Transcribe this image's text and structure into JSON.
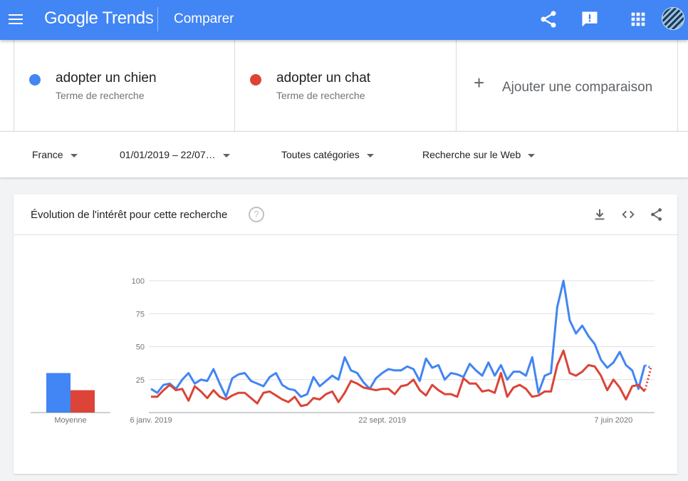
{
  "header": {
    "logo_google": "Google",
    "logo_trends": "Trends",
    "page_title": "Comparer",
    "icons": [
      "menu-icon",
      "share-icon",
      "feedback-icon",
      "apps-icon",
      "avatar"
    ],
    "bar_color": "#4285f4"
  },
  "terms": [
    {
      "name": "adopter un chien",
      "subtitle": "Terme de recherche",
      "color": "#4285f4"
    },
    {
      "name": "adopter un chat",
      "subtitle": "Terme de recherche",
      "color": "#db4437"
    }
  ],
  "add_comparison": {
    "plus": "+",
    "label": "Ajouter une comparaison"
  },
  "filters": {
    "region": "France",
    "date_range": "01/01/2019 – 22/07…",
    "category": "Toutes catégories",
    "search_type": "Recherche sur le Web"
  },
  "card": {
    "title": "Évolution de l'intérêt pour cette recherche",
    "help": "?",
    "icons": [
      "download-icon",
      "embed-icon",
      "share-icon"
    ]
  },
  "chart_data": {
    "type": "line",
    "title": "",
    "y_ticks": [
      "100",
      "75",
      "50",
      "25"
    ],
    "ylim": [
      0,
      100
    ],
    "x_ticks": [
      "6 janv. 2019",
      "22 sept. 2019",
      "7 juin 2020"
    ],
    "x_tick_index": [
      0,
      37,
      74
    ],
    "series": [
      {
        "name": "adopter un chien",
        "color": "#4285f4",
        "values": [
          18,
          15,
          21,
          22,
          18,
          25,
          30,
          22,
          25,
          24,
          33,
          22,
          12,
          26,
          29,
          30,
          24,
          22,
          20,
          27,
          30,
          21,
          18,
          17,
          12,
          14,
          27,
          20,
          24,
          28,
          25,
          42,
          32,
          30,
          23,
          18,
          26,
          30,
          33,
          32,
          32,
          35,
          33,
          24,
          41,
          34,
          36,
          25,
          30,
          29,
          27,
          37,
          32,
          28,
          38,
          28,
          36,
          25,
          31,
          31,
          28,
          42,
          15,
          28,
          30,
          80,
          100,
          70,
          60,
          66,
          58,
          52,
          40,
          34,
          38,
          46,
          36,
          32,
          18,
          36,
          34
        ]
      },
      {
        "name": "adopter un chat",
        "color": "#db4437",
        "values": [
          12,
          12,
          17,
          21,
          17,
          18,
          9,
          20,
          16,
          11,
          17,
          12,
          10,
          13,
          15,
          15,
          11,
          7,
          15,
          16,
          13,
          10,
          8,
          12,
          5,
          6,
          11,
          10,
          14,
          16,
          8,
          15,
          24,
          22,
          19,
          18,
          17,
          18,
          18,
          14,
          20,
          21,
          25,
          17,
          13,
          21,
          17,
          14,
          14,
          12,
          26,
          22,
          22,
          16,
          17,
          15,
          30,
          12,
          19,
          21,
          18,
          12,
          13,
          16,
          16,
          36,
          47,
          30,
          28,
          31,
          36,
          35,
          28,
          17,
          25,
          19,
          10,
          20,
          21,
          16,
          34
        ]
      }
    ],
    "projected_points": 2,
    "averages": {
      "labels": [
        "adopter un chien",
        "adopter un chat"
      ],
      "values": [
        30,
        17
      ],
      "caption": "Moyenne"
    }
  }
}
